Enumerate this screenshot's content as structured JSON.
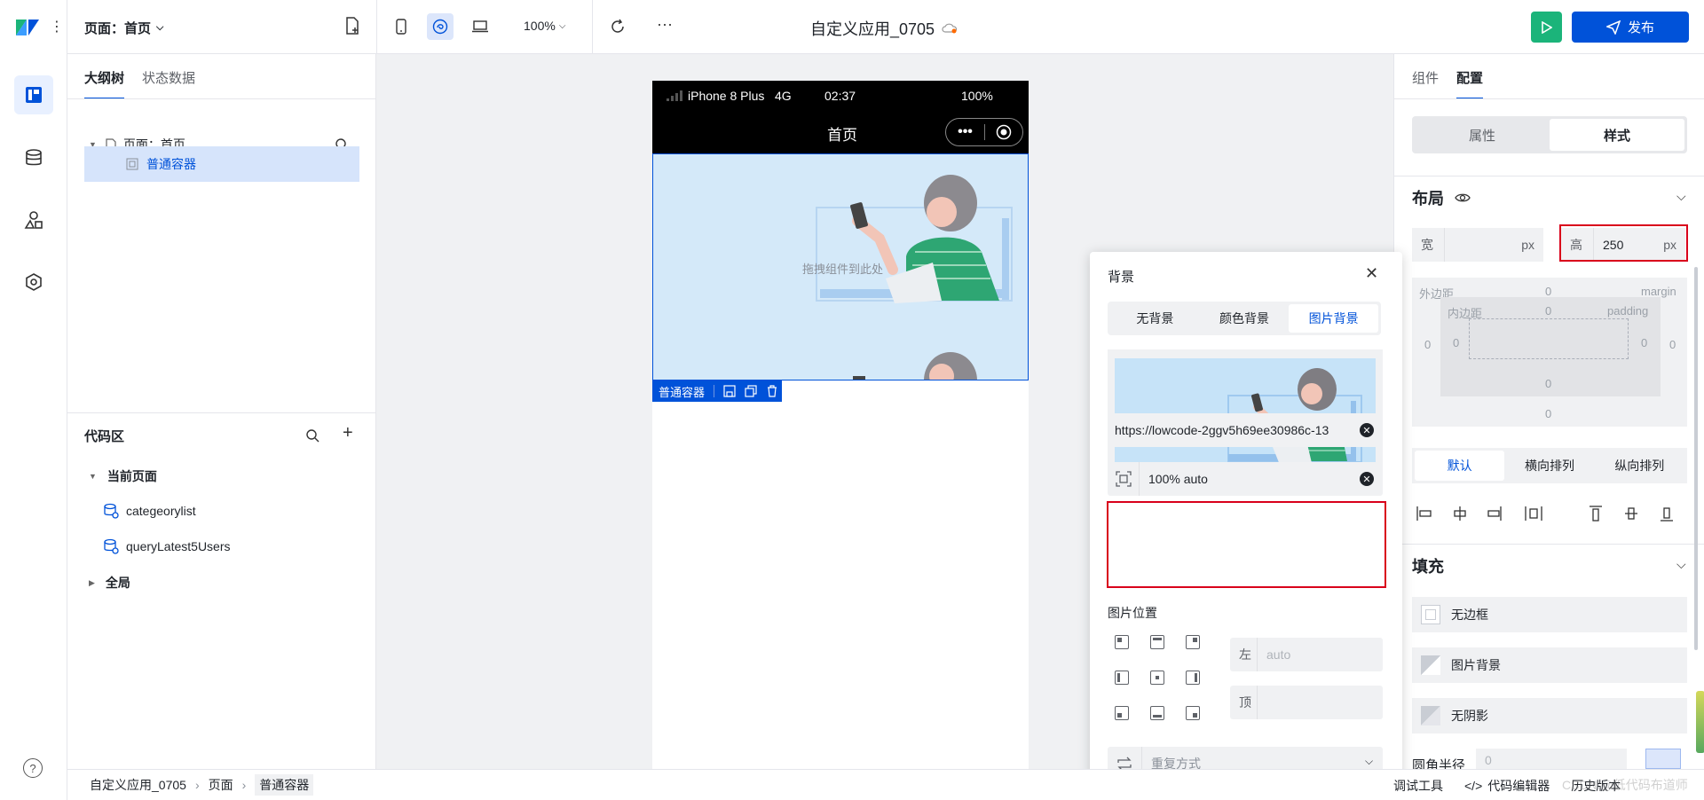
{
  "topbar": {
    "page_selector": "页面：首页",
    "zoom": "100%",
    "app_title": "自定义应用_0705",
    "publish_label": "发布"
  },
  "left_panel": {
    "tabs": [
      "大纲树",
      "状态数据"
    ],
    "tree": {
      "page_label": "页面：首页",
      "container_label": "普通容器"
    },
    "code_area": {
      "title": "代码区",
      "current_page": "当前页面",
      "items": [
        "categeorylist",
        "queryLatest5Users"
      ],
      "global": "全局"
    }
  },
  "canvas": {
    "status_bar": {
      "device": "iPhone 8 Plus",
      "network": "4G",
      "time": "02:37",
      "battery": "100%"
    },
    "nav_title": "首页",
    "drop_hint": "拖拽组件到此处",
    "selection_label": "普通容器"
  },
  "background_popover": {
    "title": "背景",
    "tabs": [
      "无背景",
      "颜色背景",
      "图片背景"
    ],
    "active_tab": "图片背景",
    "image_url": "https://lowcode-2ggv5h69ee30986c-13",
    "size_value": "100% auto",
    "position_label": "图片位置",
    "left_label": "左",
    "left_placeholder": "auto",
    "top_label": "顶",
    "repeat_placeholder": "重复方式"
  },
  "right_panel": {
    "tabs": [
      "组件",
      "配置"
    ],
    "mode_tabs": [
      "属性",
      "样式"
    ],
    "layout_title": "布局",
    "width_label": "宽",
    "height_label": "高",
    "height_value": "250",
    "unit": "px",
    "box_model": {
      "margin_label": "外边距",
      "margin_en": "margin",
      "padding_label": "内边距",
      "padding_en": "padding",
      "zero": "0"
    },
    "direction_tabs": [
      "默认",
      "横向排列",
      "纵向排列"
    ],
    "fill_title": "填充",
    "fill_items": [
      "无边框",
      "图片背景",
      "无阴影"
    ],
    "radius_label": "圆角半径",
    "radius_placeholder": "0"
  },
  "footer": {
    "breadcrumb": [
      "自定义应用_0705",
      "页面",
      "普通容器"
    ],
    "right_items": [
      "调试工具",
      "代码编辑器",
      "历史版本"
    ]
  },
  "watermark": "CSDN @低代码布道师",
  "colors": {
    "primary": "#0052d9",
    "run_green": "#1bb47a",
    "highlight_red": "#d9001b",
    "selection_bg": "#d6e4fb"
  }
}
